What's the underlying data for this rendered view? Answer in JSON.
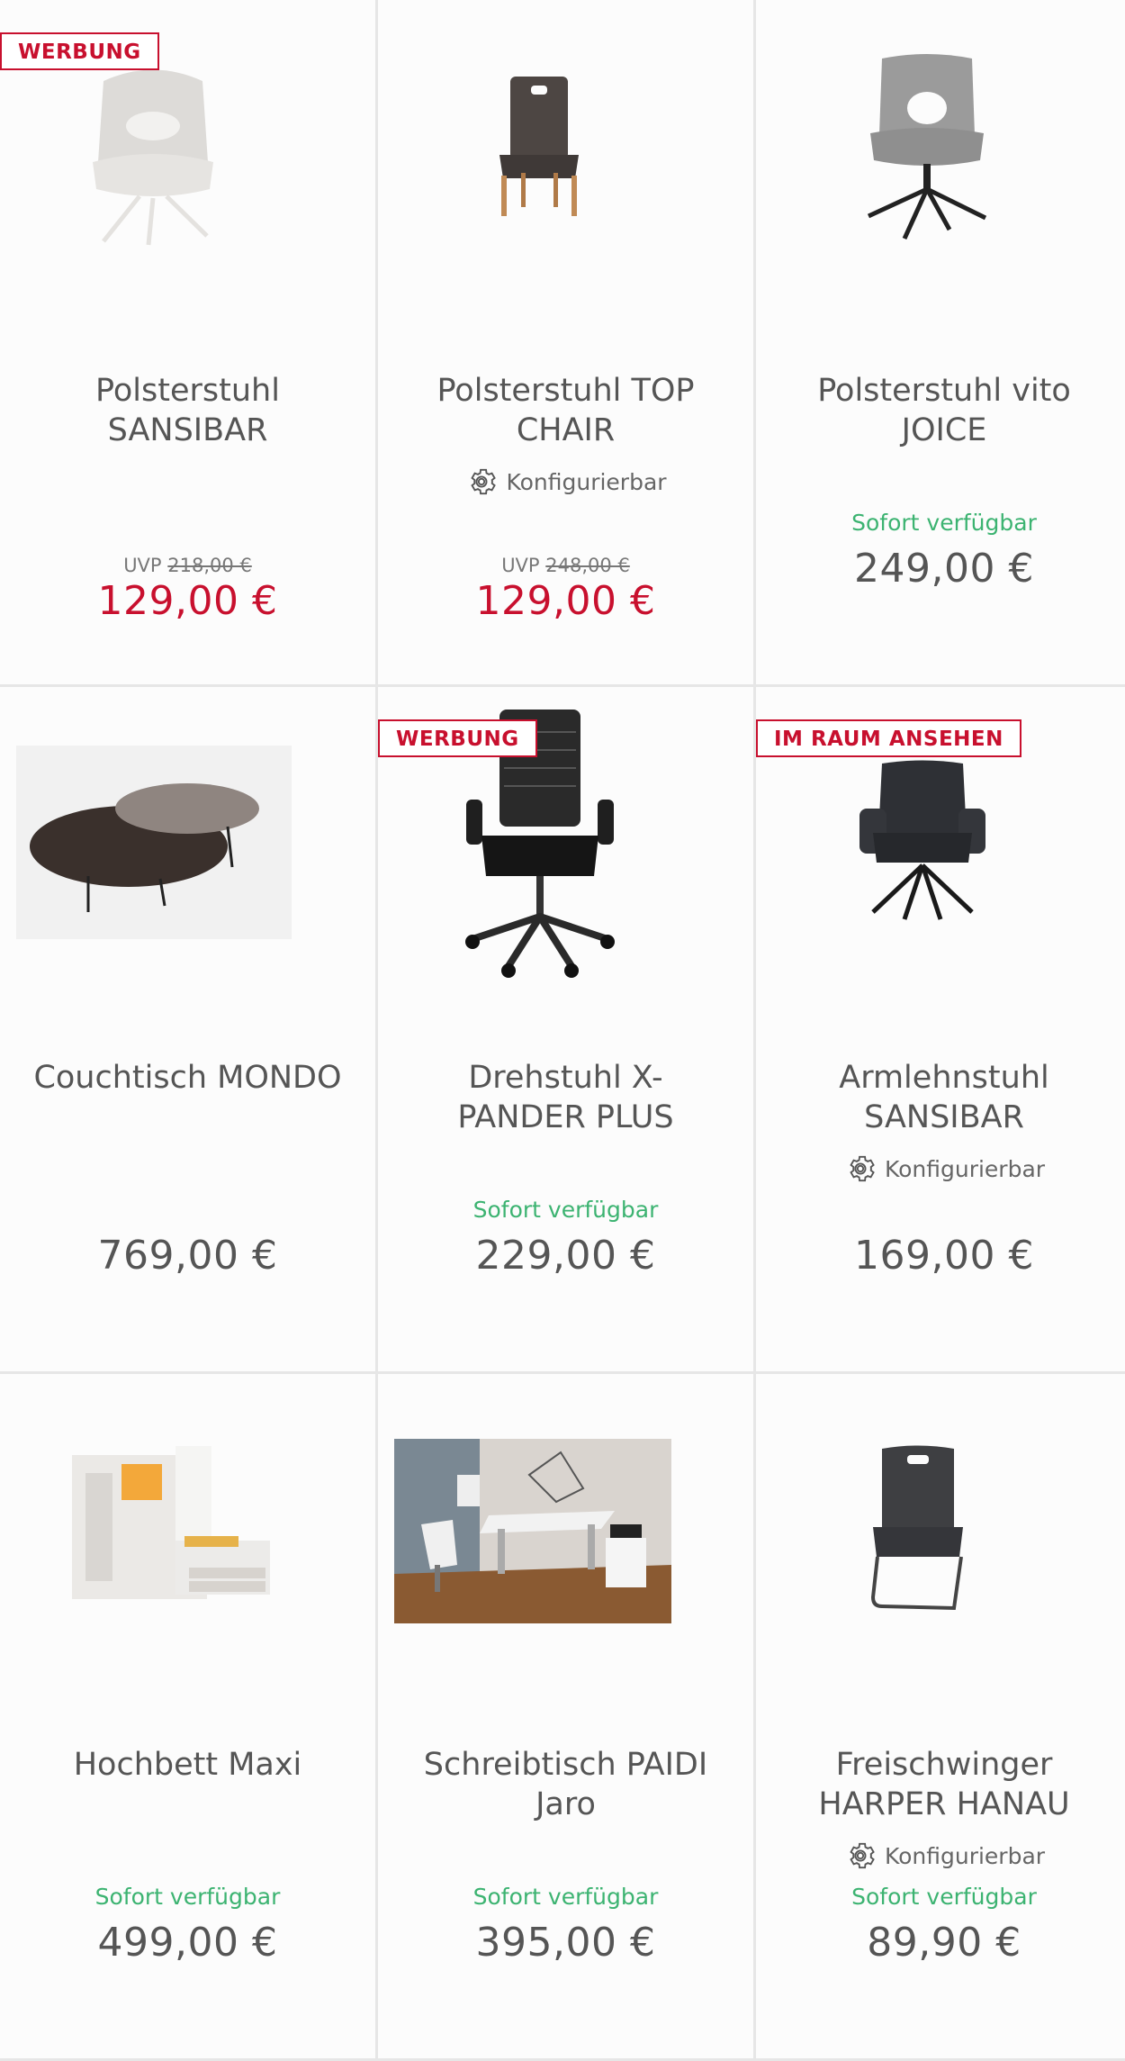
{
  "colors": {
    "sale": "#c8102e",
    "available": "#3cb371",
    "text": "#555555",
    "divider": "#e6e6e6"
  },
  "products": [
    {
      "title": "Polsterstuhl SANSIBAR",
      "badge": "WERBUNG",
      "uvp_label": "UVP",
      "uvp": "218,00 €",
      "price": "129,00 €",
      "image": "chair-light-icon"
    },
    {
      "title": "Polsterstuhl TOP CHAIR",
      "config": "Konfigurierbar",
      "uvp_label": "UVP",
      "uvp": "248,00 €",
      "price": "129,00 €",
      "image": "chair-wood-icon"
    },
    {
      "title": "Polsterstuhl vito JOICE",
      "availability": "Sofort verfügbar",
      "price": "249,00 €",
      "image": "chair-grey-swivel-icon"
    },
    {
      "title": "Couchtisch MONDO",
      "price": "769,00 €",
      "image": "coffee-table-icon"
    },
    {
      "title": "Drehstuhl X-PANDER PLUS",
      "badge": "WERBUNG",
      "availability": "Sofort verfügbar",
      "price": "229,00 €",
      "image": "office-chair-icon"
    },
    {
      "title": "Armlehnstuhl SANSIBAR",
      "badge": "IM RAUM ANSEHEN",
      "config": "Konfigurierbar",
      "price": "169,00 €",
      "image": "armchair-dark-icon"
    },
    {
      "title": "Hochbett Maxi",
      "availability": "Sofort verfügbar",
      "price": "499,00 €",
      "image": "loft-bed-icon"
    },
    {
      "title": "Schreibtisch PAIDI Jaro",
      "availability": "Sofort verfügbar",
      "price": "395,00 €",
      "image": "desk-room-icon"
    },
    {
      "title": "Freischwinger HARPER HANAU",
      "config": "Konfigurierbar",
      "availability": "Sofort verfügbar",
      "price": "89,90 €",
      "image": "cantilever-chair-icon"
    }
  ]
}
